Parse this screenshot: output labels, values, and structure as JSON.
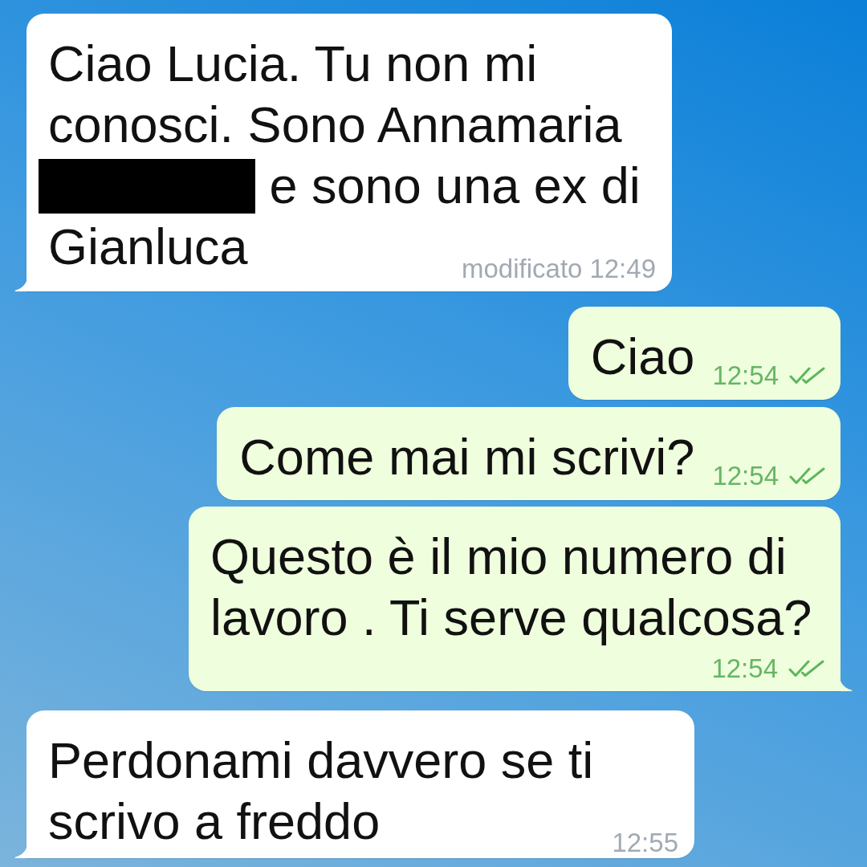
{
  "chat": {
    "messages": [
      {
        "kind": "incoming",
        "tail": true,
        "segments": [
          {
            "kind": "text",
            "text": "Ciao Lucia. Tu non mi conosci. Sono Annamaria"
          },
          {
            "kind": "redaction"
          },
          {
            "kind": "text",
            "text": "e sono una ex di"
          },
          {
            "kind": "text",
            "text": "Gianluca"
          }
        ],
        "edited_label": "modificato",
        "time": "12:49"
      },
      {
        "kind": "outgoing",
        "tail": false,
        "segments": [
          {
            "kind": "text",
            "text": "Ciao"
          }
        ],
        "time": "12:54",
        "read": true
      },
      {
        "kind": "outgoing",
        "tail": false,
        "segments": [
          {
            "kind": "text",
            "text": "Come mai mi scrivi?"
          }
        ],
        "time": "12:54",
        "read": true
      },
      {
        "kind": "outgoing",
        "tail": true,
        "segments": [
          {
            "kind": "text",
            "text": "Questo è il mio numero di lavoro . Ti serve qualcosa?"
          }
        ],
        "time": "12:54",
        "read": true
      },
      {
        "kind": "incoming",
        "tail": true,
        "segments": [
          {
            "kind": "text",
            "text": "Perdonami davvero se ti scrivo a freddo"
          }
        ],
        "time": "12:55"
      }
    ]
  }
}
